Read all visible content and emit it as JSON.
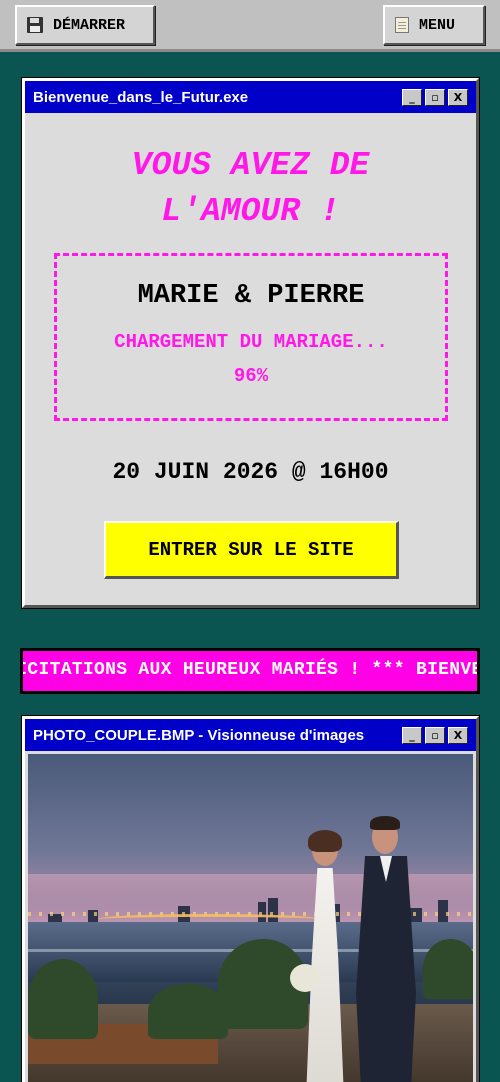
{
  "taskbar": {
    "start_label": "DÉMARRER",
    "start_icon": "floppy-disk-icon",
    "menu_label": "MENU",
    "menu_icon": "notepad-icon"
  },
  "welcome_window": {
    "title": "Bienvenue_dans_le_Futur.exe",
    "controls": {
      "minimize": "_",
      "maximize": "▫",
      "close": "X"
    },
    "headline_line1": "VOUS AVEZ DE",
    "headline_line2": "L'AMOUR !",
    "names": "MARIE & PIERRE",
    "loading_text": "CHARGEMENT DU MARIAGE...",
    "progress": "96%",
    "date_time": "20 JUIN 2026 @ 16H00",
    "enter_button": "ENTRER SUR LE SITE"
  },
  "marquee": {
    "text": "FÉLICITATIONS AUX HEUREUX MARIÉS ! *** BIENVENUE"
  },
  "photo_window": {
    "title": "PHOTO_COUPLE.BMP - Visionneuse d'images",
    "controls": {
      "minimize": "_",
      "maximize": "▫",
      "close": "X"
    }
  },
  "colors": {
    "background": "#0a5552",
    "accent_pink": "#ff18e8",
    "titlebar_blue": "#0000c8",
    "button_yellow": "#ffff00"
  }
}
